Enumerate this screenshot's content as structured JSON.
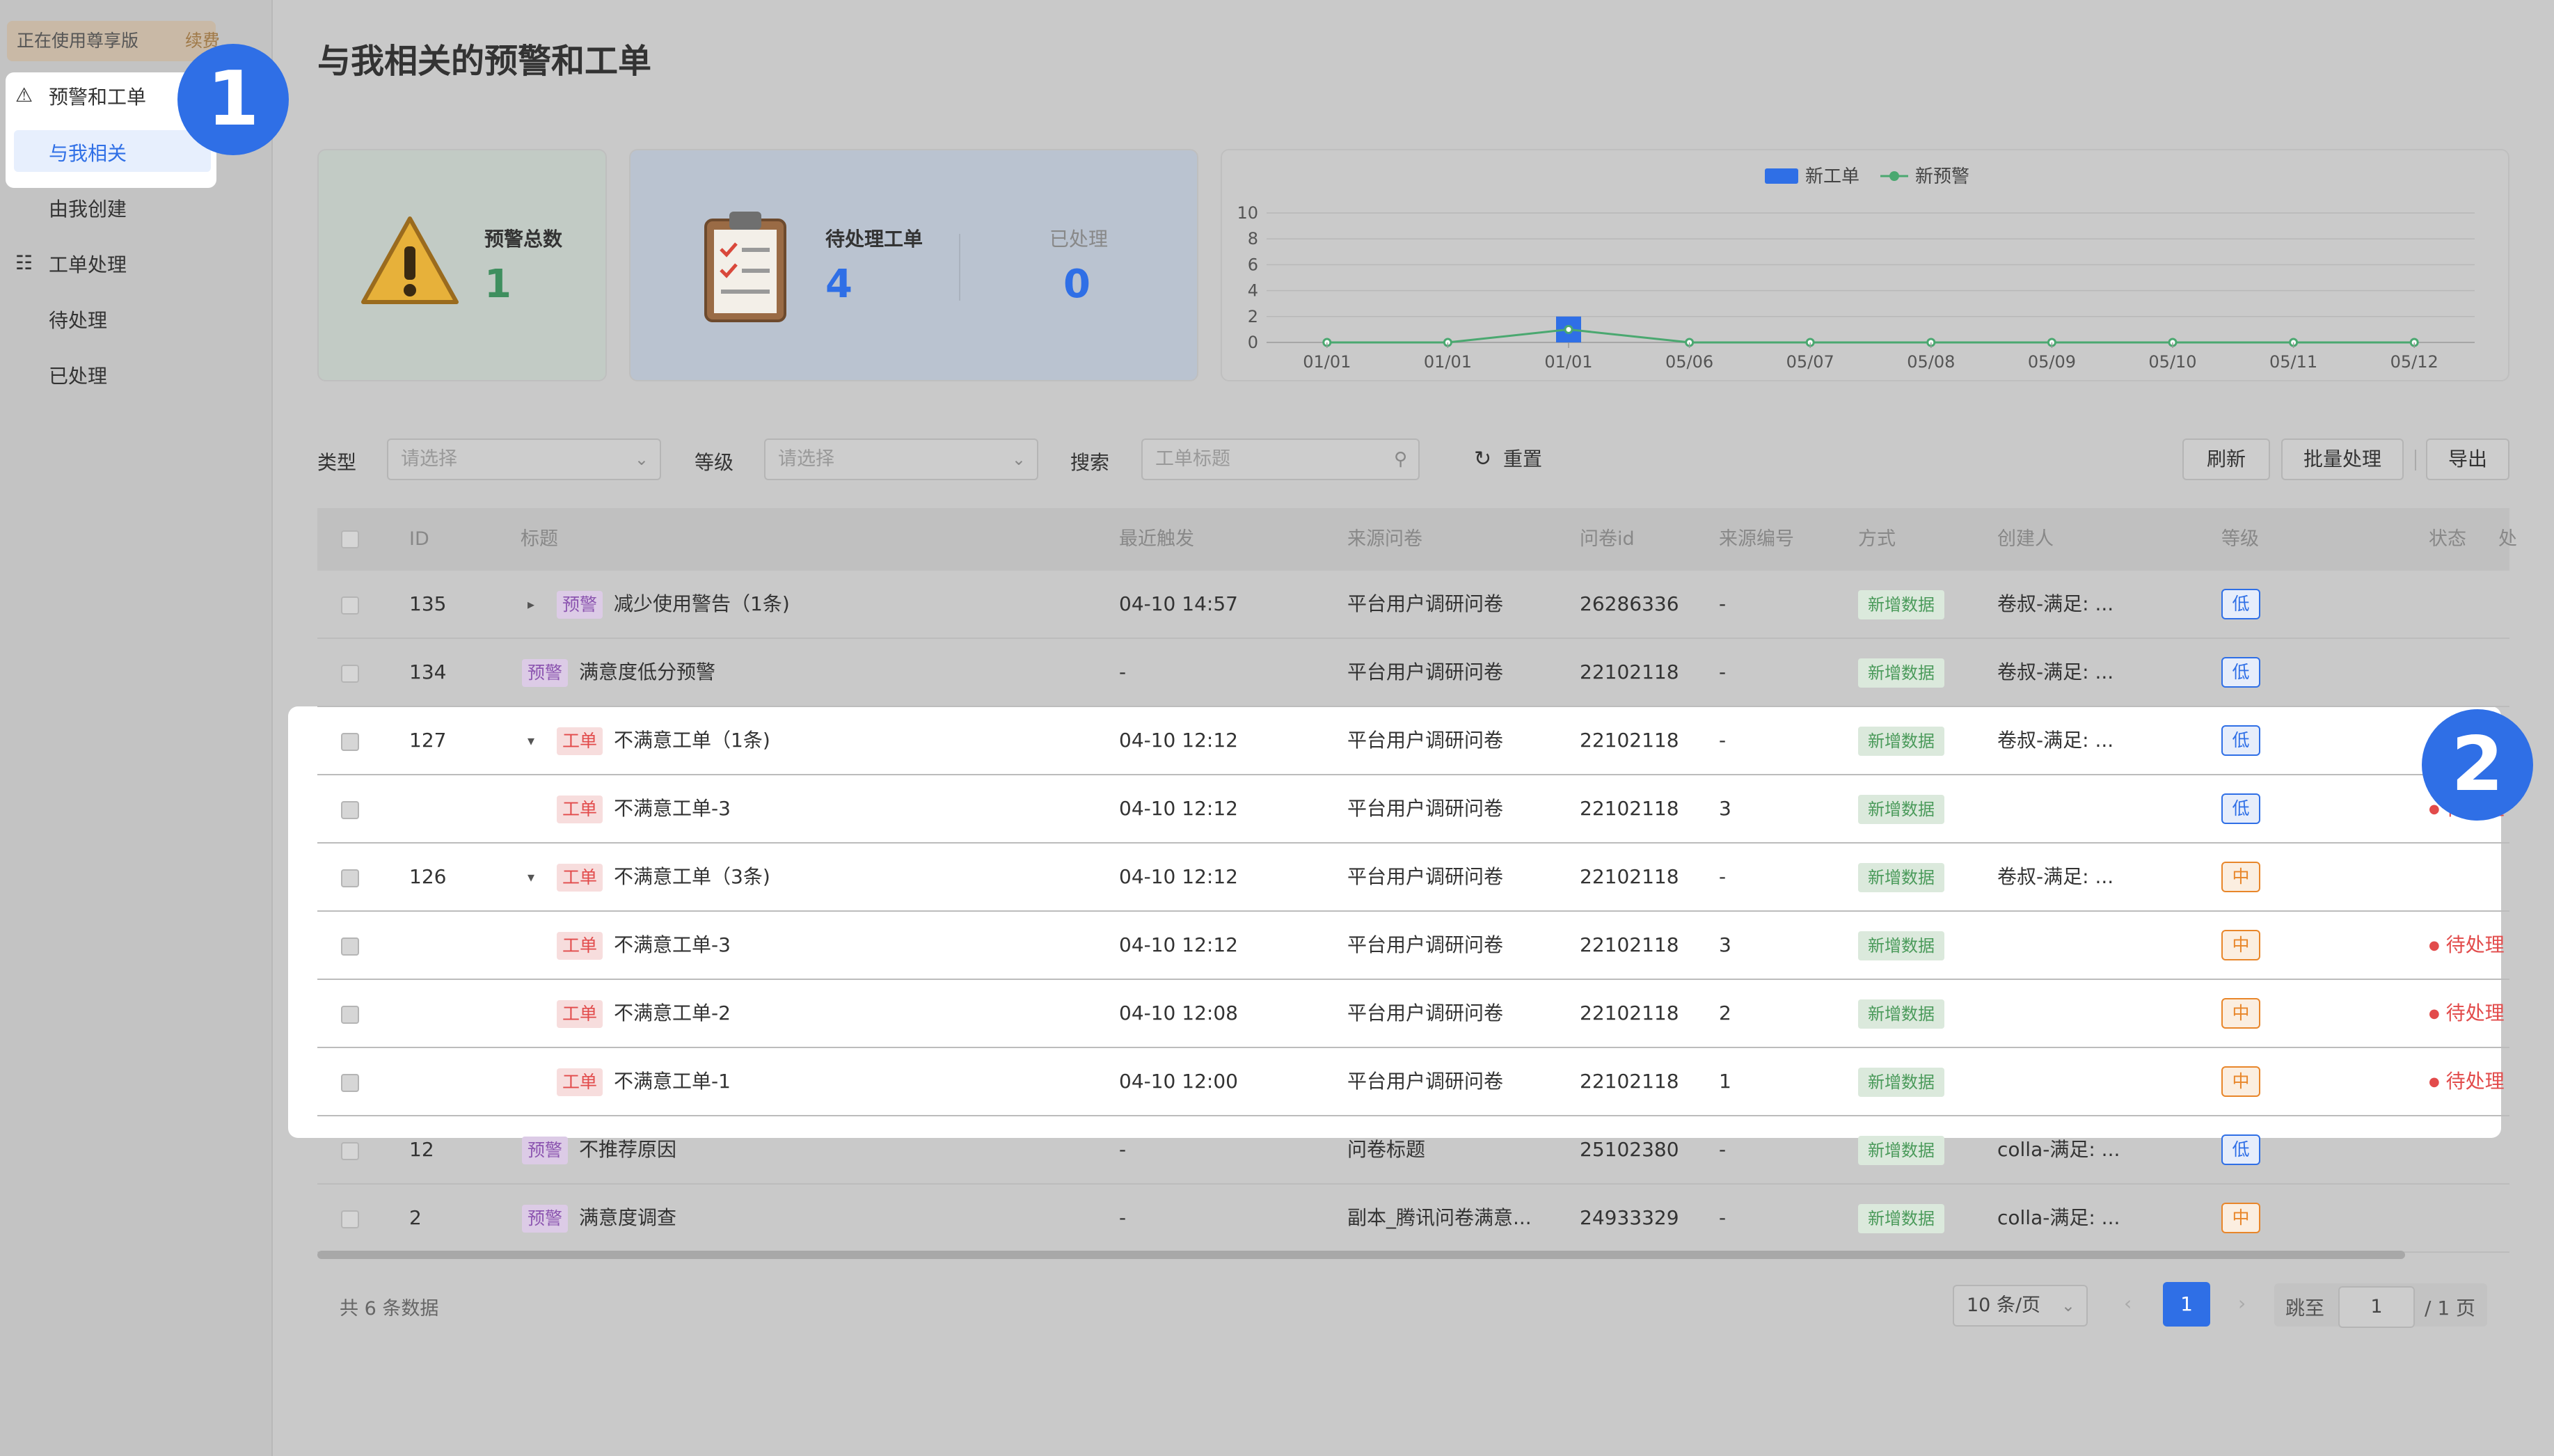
{
  "sidebar": {
    "edition_label": "正在使用尊享版",
    "upgrade_label": "续费",
    "groups": [
      {
        "label": "预警和工单",
        "items": [
          "与我相关",
          "由我创建"
        ]
      },
      {
        "label": "工单处理",
        "items": [
          "待处理",
          "已处理"
        ]
      }
    ]
  },
  "callouts": {
    "badge1": "1",
    "badge2": "2"
  },
  "page_title": "与我相关的预警和工单",
  "stats": {
    "alert_total_label": "预警总数",
    "alert_total_value": "1",
    "pending_label": "待处理工单",
    "pending_value": "4",
    "done_label": "已处理",
    "done_value": "0"
  },
  "chart_data": {
    "type": "bar+line",
    "legend": [
      "新工单",
      "新预警"
    ],
    "legend_position": "top-center",
    "categories": [
      "01/01",
      "01/01",
      "01/01",
      "05/06",
      "05/07",
      "05/08",
      "05/09",
      "05/10",
      "05/11",
      "05/12"
    ],
    "series": [
      {
        "name": "新工单",
        "type": "bar",
        "values": [
          0,
          0,
          2,
          0,
          0,
          0,
          0,
          0,
          0,
          0
        ]
      },
      {
        "name": "新预警",
        "type": "line",
        "values": [
          0,
          0,
          1,
          0,
          0,
          0,
          0,
          0,
          0,
          0
        ]
      }
    ],
    "yticks": [
      "0",
      "2",
      "4",
      "6",
      "8",
      "10"
    ],
    "ylim": [
      0,
      10
    ],
    "grid": true,
    "colors": {
      "bar": "#2f6fe6",
      "line": "#4aa870"
    }
  },
  "filters": {
    "type_label": "类型",
    "type_placeholder": "请选择",
    "level_label": "等级",
    "level_placeholder": "请选择",
    "search_label": "搜索",
    "search_placeholder": "工单标题",
    "reset_label": "重置"
  },
  "actions": {
    "refresh": "刷新",
    "batch": "批量处理",
    "export": "导出"
  },
  "table": {
    "columns": [
      "ID",
      "标题",
      "最近触发",
      "来源问卷",
      "问卷id",
      "来源编号",
      "方式",
      "创建人",
      "等级",
      "状态",
      "处"
    ],
    "rows": [
      {
        "id": "135",
        "kind": "预警",
        "title": "减少使用警告（1条)",
        "time": "04-10 14:57",
        "source": "平台用户调研问卷",
        "qid": "26286336",
        "srcno": "-",
        "way": "新增数据",
        "creator": "卷叔-满足: ...",
        "level": "低",
        "status": ""
      },
      {
        "id": "134",
        "kind": "预警",
        "title": "满意度低分预警",
        "time": "-",
        "source": "平台用户调研问卷",
        "qid": "22102118",
        "srcno": "-",
        "way": "新增数据",
        "creator": "卷叔-满足: ...",
        "level": "低",
        "status": ""
      },
      {
        "id": "127",
        "kind": "工单",
        "title": "不满意工单（1条)",
        "time": "04-10 12:12",
        "source": "平台用户调研问卷",
        "qid": "22102118",
        "srcno": "-",
        "way": "新增数据",
        "creator": "卷叔-满足: ...",
        "level": "低",
        "status": ""
      },
      {
        "id": "",
        "kind": "工单",
        "title": "不满意工单-3",
        "time": "04-10 12:12",
        "source": "平台用户调研问卷",
        "qid": "22102118",
        "srcno": "3",
        "way": "新增数据",
        "creator": "",
        "level": "低",
        "status": "待处理"
      },
      {
        "id": "126",
        "kind": "工单",
        "title": "不满意工单（3条)",
        "time": "04-10 12:12",
        "source": "平台用户调研问卷",
        "qid": "22102118",
        "srcno": "-",
        "way": "新增数据",
        "creator": "卷叔-满足: ...",
        "level": "中",
        "status": ""
      },
      {
        "id": "",
        "kind": "工单",
        "title": "不满意工单-3",
        "time": "04-10 12:12",
        "source": "平台用户调研问卷",
        "qid": "22102118",
        "srcno": "3",
        "way": "新增数据",
        "creator": "",
        "level": "中",
        "status": "待处理"
      },
      {
        "id": "",
        "kind": "工单",
        "title": "不满意工单-2",
        "time": "04-10 12:08",
        "source": "平台用户调研问卷",
        "qid": "22102118",
        "srcno": "2",
        "way": "新增数据",
        "creator": "",
        "level": "中",
        "status": "待处理"
      },
      {
        "id": "",
        "kind": "工单",
        "title": "不满意工单-1",
        "time": "04-10 12:00",
        "source": "平台用户调研问卷",
        "qid": "22102118",
        "srcno": "1",
        "way": "新增数据",
        "creator": "",
        "level": "中",
        "status": "待处理"
      },
      {
        "id": "12",
        "kind": "预警",
        "title": "不推荐原因",
        "time": "-",
        "source": "问卷标题",
        "qid": "25102380",
        "srcno": "-",
        "way": "新增数据",
        "creator": "colla-满足: ...",
        "level": "低",
        "status": ""
      },
      {
        "id": "2",
        "kind": "预警",
        "title": "满意度调查",
        "time": "-",
        "source": "副本_腾讯问卷满意...",
        "qid": "24933329",
        "srcno": "-",
        "way": "新增数据",
        "creator": "colla-满足: ...",
        "level": "中",
        "status": ""
      }
    ]
  },
  "pagination": {
    "total": "共 6 条数据",
    "page_size": "10 条/页",
    "current": "1",
    "jump_label": "跳至",
    "jump_value": "1",
    "total_pages": "/ 1 页"
  }
}
